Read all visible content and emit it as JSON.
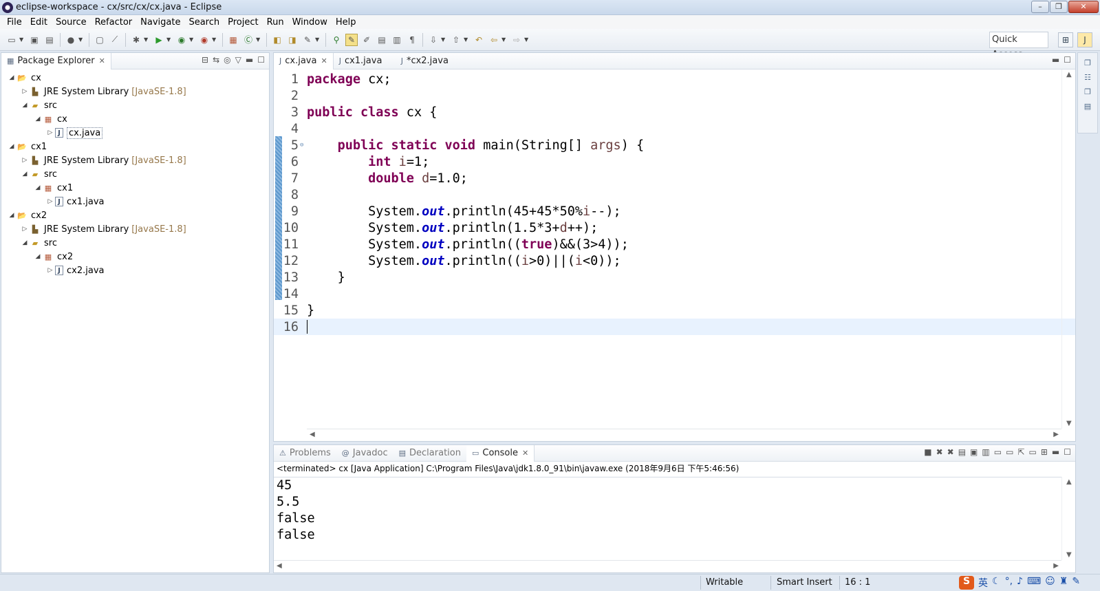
{
  "window": {
    "title": "eclipse-workspace - cx/src/cx/cx.java - Eclipse"
  },
  "menu": [
    "File",
    "Edit",
    "Source",
    "Refactor",
    "Navigate",
    "Search",
    "Project",
    "Run",
    "Window",
    "Help"
  ],
  "toolbar": {
    "quick_access": "Quick Access"
  },
  "package_explorer": {
    "title": "Package Explorer",
    "tree": [
      {
        "label": "cx",
        "suffix": "",
        "kind": "project"
      },
      {
        "label": "JRE System Library",
        "suffix": "[JavaSE-1.8]",
        "kind": "library"
      },
      {
        "label": "src",
        "suffix": "",
        "kind": "src"
      },
      {
        "label": "cx",
        "suffix": "",
        "kind": "package"
      },
      {
        "label": "cx.java",
        "suffix": "",
        "kind": "java"
      },
      {
        "label": "cx1",
        "suffix": "",
        "kind": "project"
      },
      {
        "label": "JRE System Library",
        "suffix": "[JavaSE-1.8]",
        "kind": "library"
      },
      {
        "label": "src",
        "suffix": "",
        "kind": "src"
      },
      {
        "label": "cx1",
        "suffix": "",
        "kind": "package"
      },
      {
        "label": "cx1.java",
        "suffix": "",
        "kind": "java"
      },
      {
        "label": "cx2",
        "suffix": "",
        "kind": "project"
      },
      {
        "label": "JRE System Library",
        "suffix": "[JavaSE-1.8]",
        "kind": "library"
      },
      {
        "label": "src",
        "suffix": "",
        "kind": "src"
      },
      {
        "label": "cx2",
        "suffix": "",
        "kind": "package"
      },
      {
        "label": "cx2.java",
        "suffix": "",
        "kind": "java"
      }
    ]
  },
  "editor": {
    "tabs": [
      "cx.java",
      "cx1.java",
      "*cx2.java"
    ],
    "line_numbers": [
      "1",
      "2",
      "3",
      "4",
      "5",
      "6",
      "7",
      "8",
      "9",
      "10",
      "11",
      "12",
      "13",
      "14",
      "15",
      "16"
    ],
    "code": {
      "l1_kw": "package",
      "l1_rest": " cx;",
      "l3_kw1": "public",
      "l3_kw2": "class",
      "l3_rest": " cx {",
      "l5_kw1": "public",
      "l5_kw2": "static",
      "l5_kw3": "void",
      "l5_mid": " main(String[] ",
      "l5_var": "args",
      "l5_rest": ") {",
      "l6_kw": "int",
      "l6_var": "i",
      "l6_rest": "=1;",
      "l7_kw": "double",
      "l7_var": "d",
      "l7_rest": "=1.0;",
      "sys": "System.",
      "out": "out",
      "l9_a": ".println(45+45*50%",
      "l9_v": "i",
      "l9_b": "--);",
      "l10_a": ".println(1.5*3+",
      "l10_v": "d",
      "l10_b": "++);",
      "l11_a": ".println((",
      "l11_kw": "true",
      "l11_b": ")&&(3>4));",
      "l12_a": ".println((",
      "l12_v1": "i",
      "l12_b": ">0)||(",
      "l12_v2": "i",
      "l12_c": "<0));",
      "l13": "}",
      "l15": "}"
    }
  },
  "console": {
    "tabs": [
      "Problems",
      "Javadoc",
      "Declaration",
      "Console"
    ],
    "header": "<terminated> cx [Java Application] C:\\Program Files\\Java\\jdk1.8.0_91\\bin\\javaw.exe (2018年9月6日 下午5:46:56)",
    "output": [
      "45",
      "5.5",
      "false",
      "false"
    ]
  },
  "status": {
    "writable": "Writable",
    "insert_mode": "Smart Insert",
    "position": "16 : 1"
  },
  "ime": {
    "logo": "S",
    "lang": "英"
  }
}
